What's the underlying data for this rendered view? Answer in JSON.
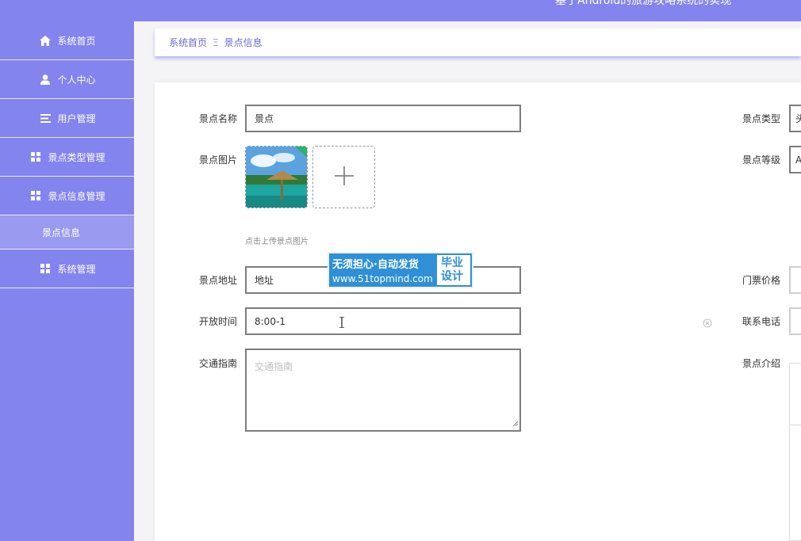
{
  "header": {
    "title": "基于Android的旅游攻略系统的实现"
  },
  "sidebar": {
    "items": [
      {
        "label": "系统首页",
        "icon": "home-icon"
      },
      {
        "label": "个人中心",
        "icon": "user-icon"
      },
      {
        "label": "用户管理",
        "icon": "menu-icon"
      },
      {
        "label": "景点类型管理",
        "icon": "grid-icon"
      },
      {
        "label": "景点信息管理",
        "icon": "grid-icon"
      },
      {
        "label": "景点信息",
        "icon": ""
      },
      {
        "label": "系统管理",
        "icon": "grid-icon"
      }
    ]
  },
  "breadcrumb": {
    "home": "系统首页",
    "separator": "Ξ",
    "current": "景点信息"
  },
  "form": {
    "name": {
      "label": "景点名称",
      "value": "景点"
    },
    "image": {
      "label": "景点图片",
      "hint": "点击上传景点图片"
    },
    "address": {
      "label": "景点地址",
      "value": "地址"
    },
    "open_time": {
      "label": "开放时间",
      "value": "8:00-1"
    },
    "traffic": {
      "label": "交通指南",
      "placeholder": "交通指南"
    },
    "type": {
      "label": "景点类型",
      "value": "头"
    },
    "level": {
      "label": "景点等级",
      "value": "A"
    },
    "price": {
      "label": "门票价格",
      "value": ""
    },
    "phone": {
      "label": "联系电话",
      "value": ""
    },
    "intro": {
      "label": "景点介绍"
    }
  },
  "watermark": {
    "line1": "无须担心·自动发货",
    "line2": "www.51topmind.com",
    "badge_line1": "毕业",
    "badge_line2": "设计"
  },
  "colors": {
    "primary": "#8484ef",
    "watermark": "#2f8fd7"
  }
}
